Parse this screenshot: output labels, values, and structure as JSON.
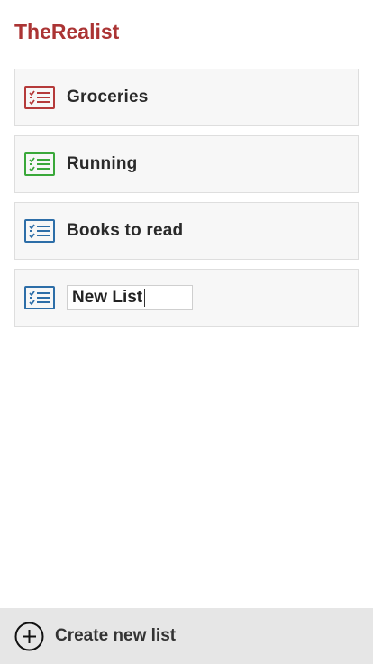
{
  "app": {
    "title": "TheRealist",
    "title_color": "#ab3434"
  },
  "lists": [
    {
      "label": "Groceries",
      "icon": "checklist-icon",
      "color": "#b53a3a"
    },
    {
      "label": "Running",
      "icon": "checklist-icon",
      "color": "#3aa83a"
    },
    {
      "label": "Books to read",
      "icon": "checklist-icon",
      "color": "#2d6ea8"
    }
  ],
  "new_list": {
    "value": "New List",
    "icon": "checklist-icon",
    "color": "#2d6ea8"
  },
  "footer": {
    "create_label": "Create new list",
    "icon": "add-circle-icon"
  }
}
